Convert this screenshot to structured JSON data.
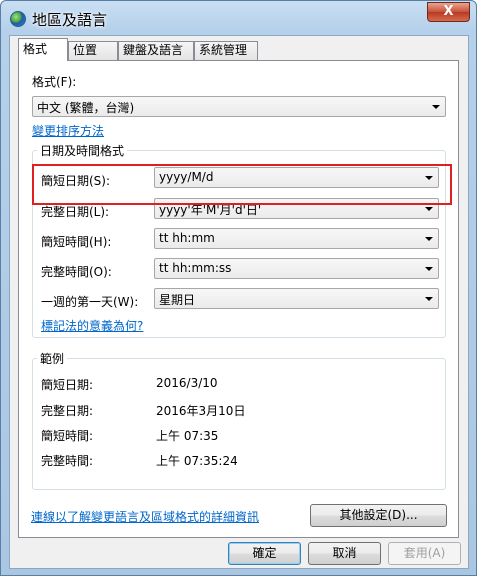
{
  "window": {
    "title": "地區及語言",
    "close_glyph": "X"
  },
  "tabs": [
    "格式",
    "位置",
    "鍵盤及語言",
    "系統管理"
  ],
  "format": {
    "label": "格式(F):",
    "value": "中文 (繁體，台灣)",
    "sort_link": "變更排序方法"
  },
  "datetime_group": {
    "title": "日期及時間格式",
    "rows": [
      {
        "label": "簡短日期(S):",
        "value": "yyyy/M/d"
      },
      {
        "label": "完整日期(L):",
        "value": "yyyy'年'M'月'd'日'"
      },
      {
        "label": "簡短時間(H):",
        "value": "tt hh:mm"
      },
      {
        "label": "完整時間(O):",
        "value": "tt hh:mm:ss"
      },
      {
        "label": "一週的第一天(W):",
        "value": "星期日"
      }
    ],
    "notation_link": "標記法的意義為何?"
  },
  "examples_group": {
    "title": "範例",
    "rows": [
      {
        "label": "簡短日期:",
        "value": "2016/3/10"
      },
      {
        "label": "完整日期:",
        "value": "2016年3月10日"
      },
      {
        "label": "簡短時間:",
        "value": "上午 07:35"
      },
      {
        "label": "完整時間:",
        "value": "上午 07:35:24"
      }
    ]
  },
  "other_settings_button": "其他設定(D)...",
  "info_link": "連線以了解變更語言及區域格式的詳細資訊",
  "footer": {
    "ok": "確定",
    "cancel": "取消",
    "apply": "套用(A)"
  },
  "colors": {
    "highlight_border": "#e02020",
    "link": "#0066cc"
  }
}
